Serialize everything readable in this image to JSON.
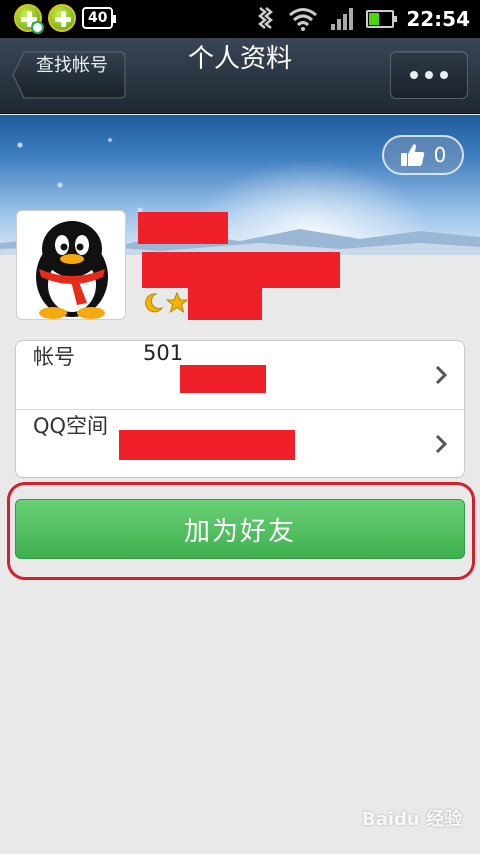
{
  "status_bar": {
    "network_badge": "40",
    "time": "22:54",
    "icons": [
      "app-360-icon",
      "app-360-icon",
      "vibrate-icon",
      "wifi-icon",
      "signal-icon",
      "battery-icon"
    ]
  },
  "header": {
    "back_label": "查找帐号",
    "title": "个人资料",
    "more_label": "•••"
  },
  "cover": {
    "like_count": "0",
    "like_icon": "thumbs-up-icon"
  },
  "profile": {
    "avatar_icon": "qq-penguin-avatar-icon",
    "level_icons": [
      "moon-icon",
      "star-icon"
    ]
  },
  "info": {
    "rows": [
      {
        "label": "帐号",
        "value": "501"
      },
      {
        "label": "QQ空间",
        "value": ""
      }
    ]
  },
  "actions": {
    "add_friend": "加为好友"
  },
  "watermark": "Baidu 经验",
  "colors": {
    "accent_green": "#4cbf5c",
    "highlight_red": "#d3202c",
    "redaction_red": "#f0202a",
    "titlebar": "#2a3441"
  }
}
